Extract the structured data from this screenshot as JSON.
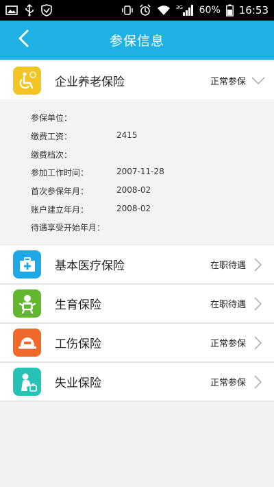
{
  "status_bar": {
    "battery": "60%",
    "time": "16:53",
    "network": "3G"
  },
  "header": {
    "title": "参保信息"
  },
  "expanded_item": {
    "label": "企业养老保险",
    "status": "正常参保"
  },
  "details": [
    {
      "label": "参保单位：",
      "value": ""
    },
    {
      "label": "缴费工资：",
      "value": "2415"
    },
    {
      "label": "缴费档次：",
      "value": ""
    },
    {
      "label": "参加工作时间：",
      "value": "2007-11-28"
    },
    {
      "label": "首次参保年月：",
      "value": "2008-02"
    },
    {
      "label": "账户建立年月：",
      "value": "2008-02"
    },
    {
      "label": "待遇享受开始年月：",
      "value": ""
    }
  ],
  "items": [
    {
      "label": "基本医疗保险",
      "status": "在职待遇"
    },
    {
      "label": "生育保险",
      "status": "在职待遇"
    },
    {
      "label": "工伤保险",
      "status": "正常参保"
    },
    {
      "label": "失业保险",
      "status": "正常参保"
    }
  ],
  "icons": {
    "pension": "wheelchair-icon",
    "medical": "medical-kit-icon",
    "maternity": "baby-icon",
    "injury": "hard-hat-icon",
    "unemployment": "worker-icon"
  },
  "colors": {
    "header": "#1fb1e4",
    "pension": "#f2c524",
    "medical": "#1fa8e6",
    "maternity": "#63b72f",
    "injury": "#ef6a2a",
    "unemployment": "#27c2b6"
  }
}
